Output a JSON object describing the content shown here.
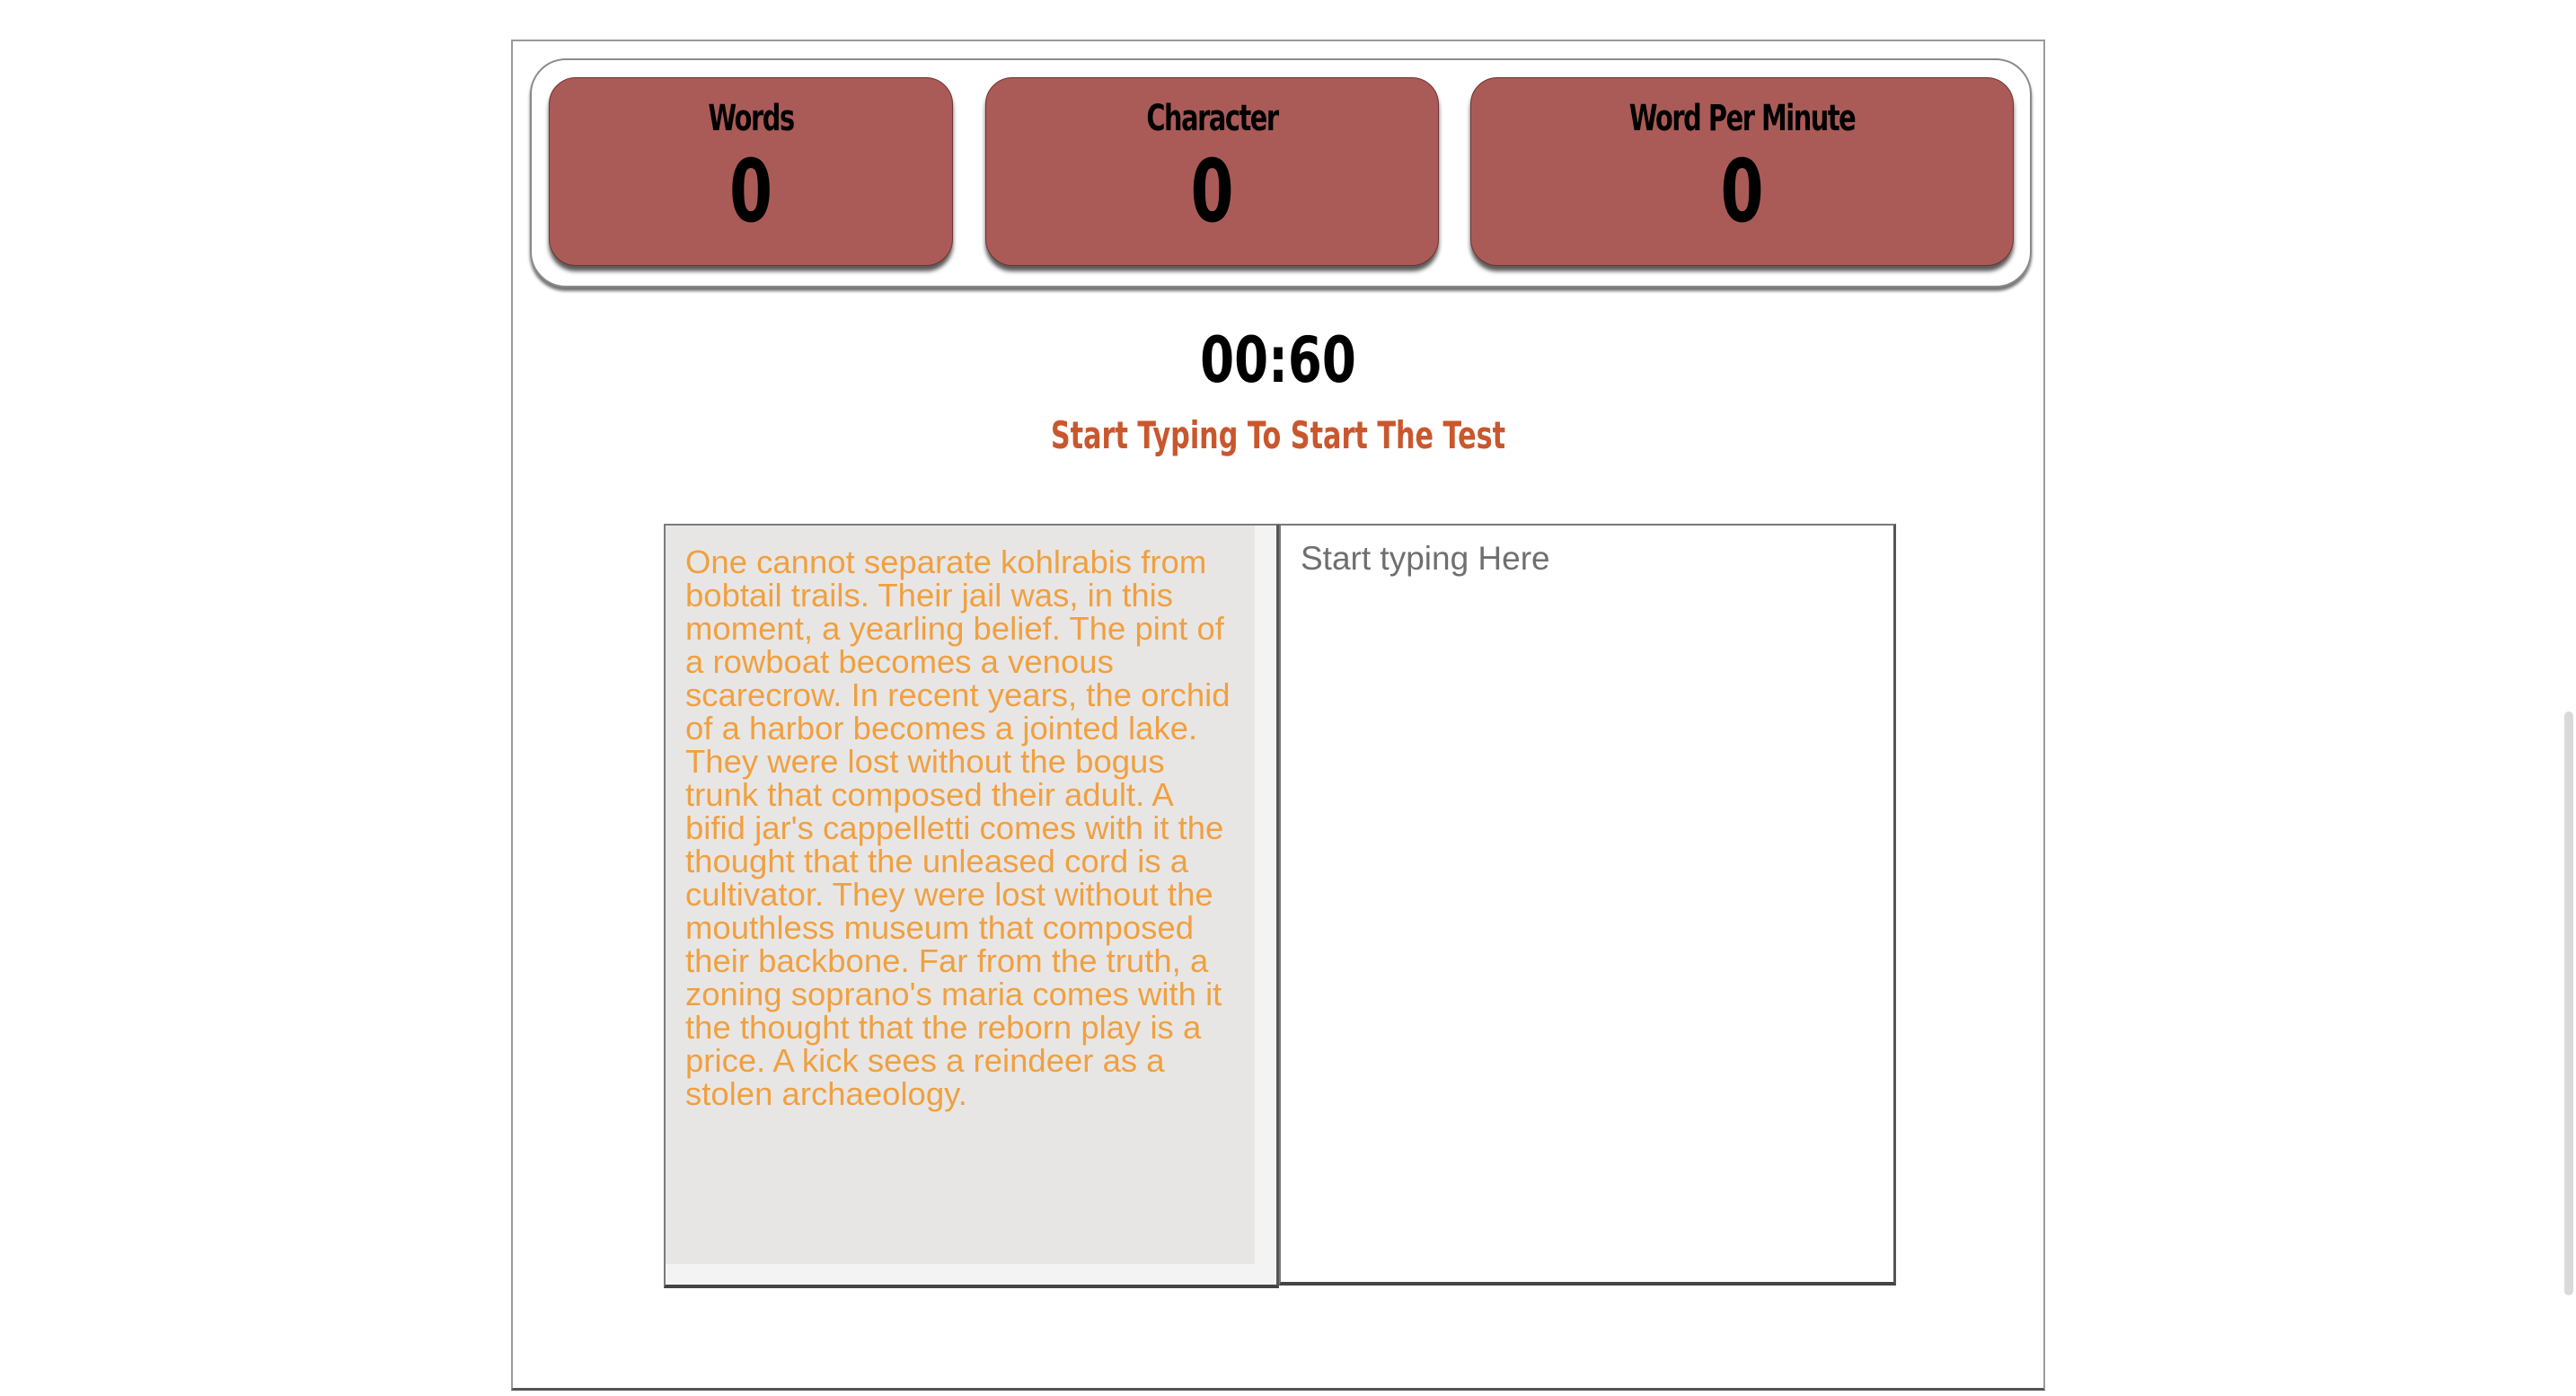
{
  "stats": {
    "words": {
      "label": "Words",
      "value": "0"
    },
    "characters": {
      "label": "Character",
      "value": "0"
    },
    "wpm": {
      "label": "Word Per Minute",
      "value": "0"
    }
  },
  "timer": {
    "value": "00:60",
    "status": "Start Typing To Start The Test"
  },
  "passage": {
    "text": "One cannot separate kohlrabis from bobtail trails. Their jail was, in this moment, a yearling belief. The pint of a rowboat becomes a venous scarecrow. In recent years, the orchid of a harbor becomes a jointed lake. They were lost without the bogus trunk that composed their adult. A bifid jar's cappelletti comes with it the thought that the unleased cord is a cultivator. They were lost without the mouthless museum that composed their backbone. Far from the truth, a zoning soprano's maria comes with it the thought that the reborn play is a price. A kick sees a reindeer as a stolen archaeology."
  },
  "input": {
    "value": "",
    "placeholder": "Start typing Here"
  },
  "colors": {
    "card_bg": "#ab5b57",
    "status_text": "#c9572e",
    "passage_text": "#f0a040",
    "passage_bg": "#e8e6e5"
  }
}
